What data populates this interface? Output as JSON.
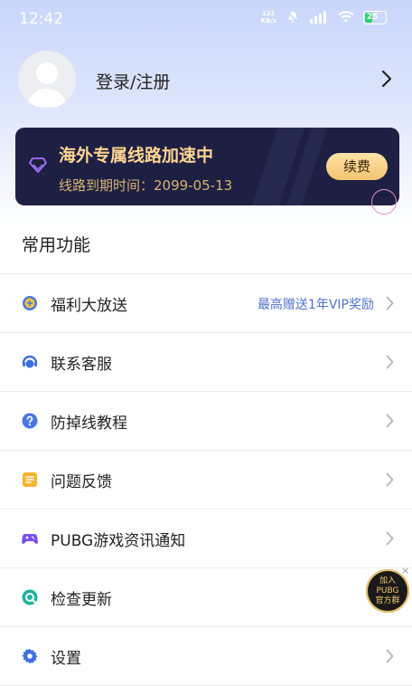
{
  "status_bar": {
    "time": "12:42",
    "net_speed_value": "121",
    "net_speed_unit": "KB/s",
    "battery": "25"
  },
  "profile": {
    "login_label": "登录/注册"
  },
  "vip_banner": {
    "title": "海外专属线路加速中",
    "expiry_label": "线路到期时间：2099-05-13",
    "renew_label": "续费"
  },
  "section_title": "常用功能",
  "menu": [
    {
      "label": "福利大放送",
      "extra": "最高赠送1年VIP奖励",
      "icon": "gift-globe-icon"
    },
    {
      "label": "联系客服",
      "extra": "",
      "icon": "customer-service-icon"
    },
    {
      "label": "防掉线教程",
      "extra": "",
      "icon": "question-icon"
    },
    {
      "label": "问题反馈",
      "extra": "",
      "icon": "feedback-icon"
    },
    {
      "label": "PUBG游戏资讯通知",
      "extra": "",
      "icon": "gamepad-icon"
    },
    {
      "label": "检查更新",
      "extra": "",
      "icon": "update-icon"
    },
    {
      "label": "设置",
      "extra": "",
      "icon": "gear-icon"
    }
  ],
  "float_badge": {
    "line1": "加入",
    "line2": "PUBG",
    "line3": "官方群",
    "close": "×"
  },
  "colors": {
    "accent_blue": "#4f73c9",
    "vip_gold": "#ffd591",
    "vip_bg": "#1d1f43"
  }
}
